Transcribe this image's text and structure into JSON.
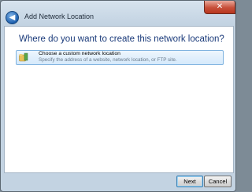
{
  "window": {
    "title": "Add Network Location",
    "close_glyph": "✕",
    "back_glyph": "◀"
  },
  "main": {
    "heading": "Where do you want to create this network location?",
    "options": [
      {
        "title": "Choose a custom network location",
        "description": "Specify the address of a website, network location, or FTP site.",
        "icon": "folder-icon"
      }
    ]
  },
  "footer": {
    "next_label": "Next",
    "cancel_label": "Cancel"
  },
  "colors": {
    "heading": "#1a3a7a",
    "selection_border": "#7fb3e0",
    "close_red": "#c7503a"
  }
}
